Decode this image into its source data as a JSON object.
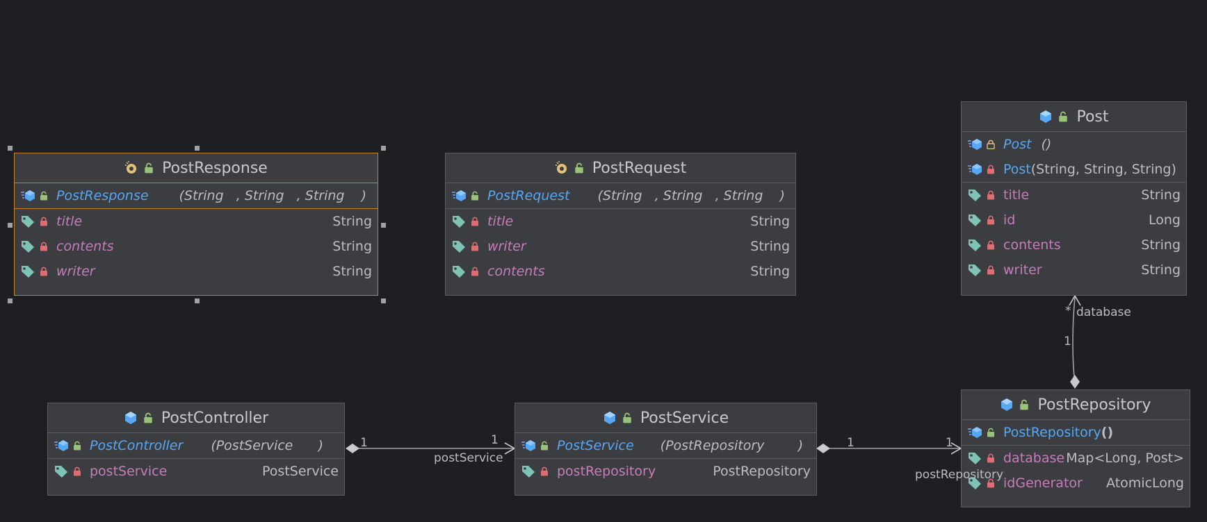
{
  "colors": {
    "background": "#1e1f22",
    "box": "#3c3d40",
    "border": "#5a5c62",
    "selected_border": "#c8822a",
    "field": "#c77dbb",
    "method": "#56a8f5",
    "text": "#bcbec4",
    "lock_private": "#e06c75",
    "lock_public": "#98c379"
  },
  "classes": {
    "post_response": {
      "name": "PostResponse",
      "ctor": {
        "name": "PostResponse",
        "params": "(String   , String   , String    )"
      },
      "fields": [
        {
          "name": "title",
          "type": "String"
        },
        {
          "name": "contents",
          "type": "String"
        },
        {
          "name": "writer",
          "type": "String"
        }
      ]
    },
    "post_request": {
      "name": "PostRequest",
      "ctor": {
        "name": "PostRequest",
        "params": "(String   , String   , String    )"
      },
      "fields": [
        {
          "name": "title",
          "type": "String"
        },
        {
          "name": "writer",
          "type": "String"
        },
        {
          "name": "contents",
          "type": "String"
        }
      ]
    },
    "post": {
      "name": "Post",
      "ctors": [
        {
          "name": "Post",
          "params": " ()"
        },
        {
          "name": "Post",
          "params": "(String, String, String)"
        }
      ],
      "fields": [
        {
          "name": "title",
          "type": "String"
        },
        {
          "name": "id",
          "type": "Long"
        },
        {
          "name": "contents",
          "type": "String"
        },
        {
          "name": "writer",
          "type": "String"
        }
      ]
    },
    "post_controller": {
      "name": "PostController",
      "ctor": {
        "name": "PostController",
        "params": "(PostService      )"
      },
      "fields": [
        {
          "name": "postService",
          "type": "PostService"
        }
      ]
    },
    "post_service": {
      "name": "PostService",
      "ctor": {
        "name": "PostService",
        "params": "(PostRepository        )"
      },
      "fields": [
        {
          "name": "postRepository",
          "type": "PostRepository"
        }
      ]
    },
    "post_repository": {
      "name": "PostRepository",
      "ctor": {
        "name": "PostRepository",
        "params": "()"
      },
      "fields": [
        {
          "name": "database",
          "type": "Map<Long, Post>"
        },
        {
          "name": "idGenerator",
          "type": "AtomicLong"
        }
      ]
    }
  },
  "relations": {
    "controller_service": {
      "from_mult": "1",
      "to_mult": "1",
      "role": "postService"
    },
    "service_repository": {
      "from_mult": "1",
      "to_mult": "1",
      "role": "postRepository"
    },
    "repository_post": {
      "from_mult": "1",
      "to_mult": "*",
      "role": "database"
    }
  }
}
